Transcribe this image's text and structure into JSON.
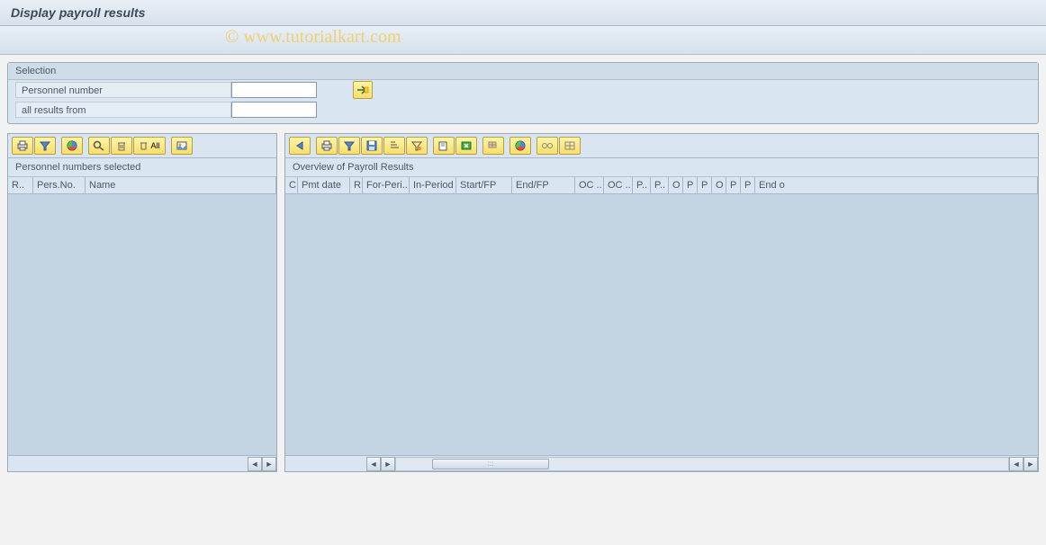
{
  "title": "Display payroll results",
  "watermark": "© www.tutorialkart.com",
  "selection": {
    "header": "Selection",
    "personnel_label": "Personnel number",
    "results_from_label": "all results from"
  },
  "left_panel": {
    "title": "Personnel numbers selected",
    "columns": [
      "R..",
      "Pers.No.",
      "Name"
    ]
  },
  "right_panel": {
    "title": "Overview of Payroll Results",
    "columns": [
      "C",
      "Pmt date",
      "R",
      "For-Peri..",
      "In-Period",
      "Start/FP",
      "End/FP",
      "OC ..",
      "OC ..",
      "P..",
      "P..",
      "O",
      "P",
      "P",
      "O",
      "P",
      "P",
      "End o"
    ]
  },
  "toolbar_left": {
    "btn_print": "print-icon",
    "btn_filter": "filter-icon",
    "btn_chart": "chart-icon",
    "btn_find": "find-icon",
    "btn_delete": "delete-icon",
    "btn_deleteall": "All",
    "btn_expand": "expand-icon"
  },
  "toolbar_right": {
    "btn_back": "back-icon"
  }
}
